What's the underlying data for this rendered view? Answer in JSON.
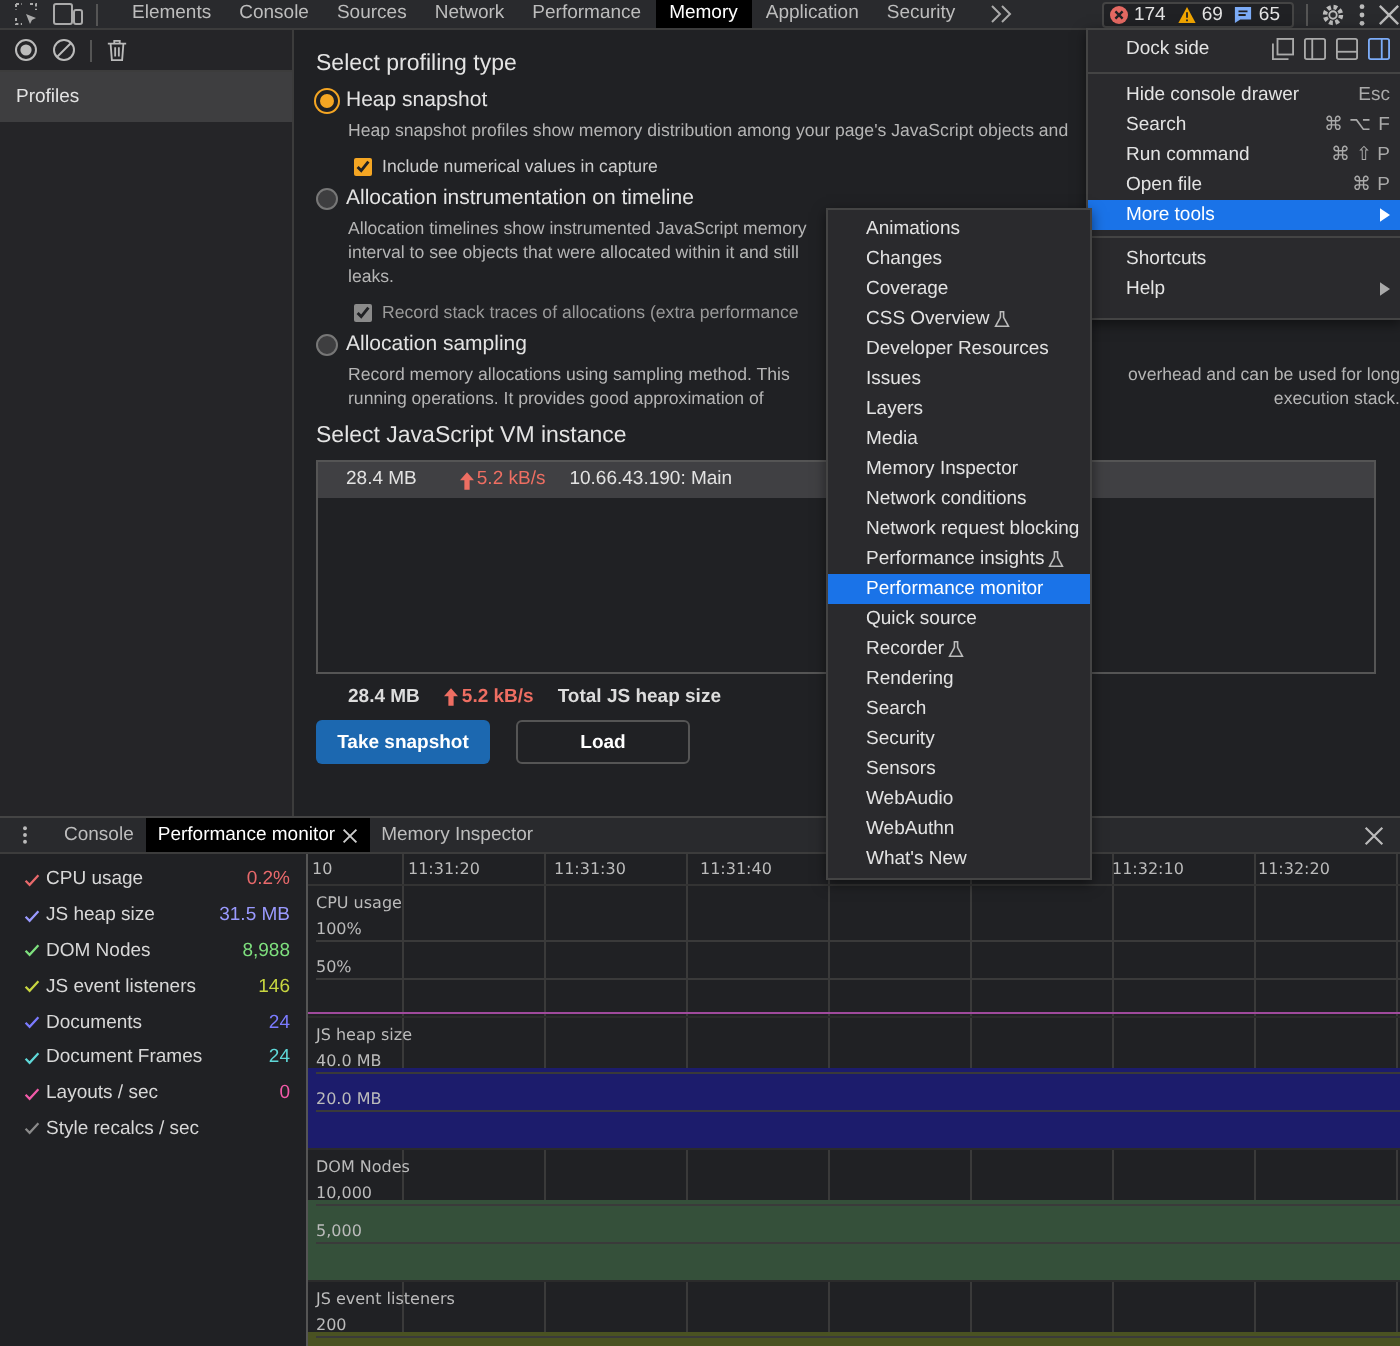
{
  "toolbar": {
    "tabs": [
      {
        "label": "Elements",
        "selected": false
      },
      {
        "label": "Console",
        "selected": false
      },
      {
        "label": "Sources",
        "selected": false
      },
      {
        "label": "Network",
        "selected": false
      },
      {
        "label": "Performance",
        "selected": false
      },
      {
        "label": "Memory",
        "selected": true
      },
      {
        "label": "Application",
        "selected": false
      },
      {
        "label": "Security",
        "selected": false
      }
    ],
    "counters": [
      {
        "kind": "error",
        "count": "174"
      },
      {
        "kind": "warning",
        "count": "69"
      },
      {
        "kind": "info",
        "count": "65"
      }
    ]
  },
  "sidebar": {
    "items": [
      {
        "label": "Profiles",
        "selected": true
      }
    ]
  },
  "profiling": {
    "title": "Select profiling type",
    "types": [
      {
        "label": "Heap snapshot",
        "selected": true,
        "desc": [
          [
            "Heap snapshot profiles show memory distribution among your page's JavaScript objects and"
          ]
        ],
        "option": {
          "label": "Include numerical values in capture",
          "checked": true,
          "disabled": false
        }
      },
      {
        "label": "Allocation instrumentation on timeline",
        "selected": false,
        "desc": [
          [
            "Allocation timelines show instrumented JavaScript memory"
          ],
          [
            "interval to see objects that were allocated within it and still"
          ],
          [
            "leaks."
          ]
        ],
        "option": {
          "label": "Record stack traces of allocations (extra performance",
          "checked": true,
          "disabled": true
        }
      },
      {
        "label": "Allocation sampling",
        "selected": false,
        "desc": [
          [
            "Record memory allocations using sampling method. This",
            "overhead and can be used for long"
          ],
          [
            "running operations. It provides good approximation of",
            "execution stack."
          ]
        ]
      }
    ]
  },
  "vm": {
    "title": "Select JavaScript VM instance",
    "rows": [
      {
        "size": "28.4 MB",
        "rate": "5.2 kB/s",
        "name": "10.66.43.190: Main",
        "selected": true
      }
    ],
    "total": {
      "size": "28.4 MB",
      "rate": "5.2 kB/s",
      "label": "Total JS heap size"
    },
    "buttons": [
      {
        "label": "Take snapshot",
        "kind": "primary"
      },
      {
        "label": "Load",
        "kind": "secondary"
      }
    ]
  },
  "drawer": {
    "tabs": [
      {
        "label": "Console",
        "selected": false,
        "closable": false
      },
      {
        "label": "Performance monitor",
        "selected": true,
        "closable": true
      },
      {
        "label": "Memory Inspector",
        "selected": false,
        "closable": false
      }
    ],
    "metrics": [
      {
        "label": "CPU usage",
        "value": "0.2%",
        "checked": true,
        "color": "#e8696b"
      },
      {
        "label": "JS heap size",
        "value": "31.5 MB",
        "checked": true,
        "color": "#9a9aff"
      },
      {
        "label": "DOM Nodes",
        "value": "8,988",
        "checked": true,
        "color": "#7ee07e"
      },
      {
        "label": "JS event listeners",
        "value": "146",
        "checked": true,
        "color": "#c8d640"
      },
      {
        "label": "Documents",
        "value": "24",
        "checked": true,
        "color": "#7b7bff"
      },
      {
        "label": "Document Frames",
        "value": "24",
        "checked": true,
        "color": "#5fd8d8"
      },
      {
        "label": "Layouts / sec",
        "value": "0",
        "checked": true,
        "color": "#f25aa8"
      },
      {
        "label": "Style recalcs / sec",
        "checked": true,
        "color": "#8a8a8a"
      }
    ],
    "time_ticks": [
      [
        "10",
        "11:31:20",
        "11:31:30",
        "11:31:40"
      ],
      [
        "11:32:10",
        "11:32:20"
      ]
    ],
    "tracks": [
      {
        "title": "CPU usage",
        "ticks": [
          "100%",
          "50%"
        ],
        "kind": "line",
        "color": "#a04a9c"
      },
      {
        "title": "JS heap size",
        "ticks": [
          "40.0 MB",
          "20.0 MB"
        ],
        "kind": "area",
        "color": "#1c1c6c"
      },
      {
        "title": "DOM Nodes",
        "ticks": [
          "10,000",
          "5,000"
        ],
        "kind": "area",
        "color": "#35503a"
      },
      {
        "title": "JS event listeners",
        "ticks": [
          "200"
        ],
        "kind": "area",
        "color": "#4a5222"
      }
    ]
  },
  "main_menu": {
    "dock_label": "Dock side",
    "dock_options": [
      {
        "kind": "undock",
        "selected": false
      },
      {
        "kind": "left",
        "selected": false
      },
      {
        "kind": "bottom",
        "selected": false
      },
      {
        "kind": "right",
        "selected": true
      }
    ],
    "groups": [
      [
        {
          "label": "Hide console drawer",
          "shortcut": "Esc",
          "submenu": false,
          "highlighted": false
        },
        {
          "label": "Search",
          "shortcut": "⌘ ⌥ F",
          "submenu": false,
          "highlighted": false
        },
        {
          "label": "Run command",
          "shortcut": "⌘ ⇧ P",
          "submenu": false,
          "highlighted": false
        },
        {
          "label": "Open file",
          "shortcut": "⌘ P",
          "submenu": false,
          "highlighted": false
        },
        {
          "label": "More tools",
          "submenu": true,
          "highlighted": true
        }
      ],
      [
        {
          "label": "Shortcuts",
          "submenu": false,
          "highlighted": false
        },
        {
          "label": "Help",
          "submenu": true,
          "highlighted": false
        }
      ]
    ]
  },
  "submenu": {
    "items": [
      {
        "label": "Animations",
        "experimental": false,
        "selected": false
      },
      {
        "label": "Changes",
        "experimental": false,
        "selected": false
      },
      {
        "label": "Coverage",
        "experimental": false,
        "selected": false
      },
      {
        "label": "CSS Overview",
        "experimental": true,
        "selected": false
      },
      {
        "label": "Developer Resources",
        "experimental": false,
        "selected": false
      },
      {
        "label": "Issues",
        "experimental": false,
        "selected": false
      },
      {
        "label": "Layers",
        "experimental": false,
        "selected": false
      },
      {
        "label": "Media",
        "experimental": false,
        "selected": false
      },
      {
        "label": "Memory Inspector",
        "experimental": false,
        "selected": false
      },
      {
        "label": "Network conditions",
        "experimental": false,
        "selected": false
      },
      {
        "label": "Network request blocking",
        "experimental": false,
        "selected": false
      },
      {
        "label": "Performance insights",
        "experimental": true,
        "selected": false
      },
      {
        "label": "Performance monitor",
        "experimental": false,
        "selected": true
      },
      {
        "label": "Quick source",
        "experimental": false,
        "selected": false
      },
      {
        "label": "Recorder",
        "experimental": true,
        "selected": false
      },
      {
        "label": "Rendering",
        "experimental": false,
        "selected": false
      },
      {
        "label": "Search",
        "experimental": false,
        "selected": false
      },
      {
        "label": "Security",
        "experimental": false,
        "selected": false
      },
      {
        "label": "Sensors",
        "experimental": false,
        "selected": false
      },
      {
        "label": "WebAudio",
        "experimental": false,
        "selected": false
      },
      {
        "label": "WebAuthn",
        "experimental": false,
        "selected": false
      },
      {
        "label": "What's New",
        "experimental": false,
        "selected": false
      }
    ]
  }
}
